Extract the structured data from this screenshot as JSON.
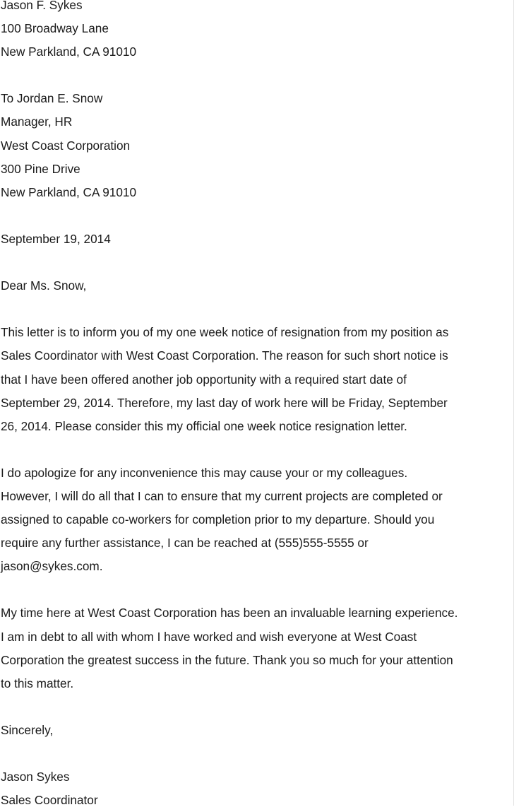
{
  "sender": {
    "name": "Jason F. Sykes",
    "street": "100 Broadway Lane",
    "city_line": "New Parkland, CA 91010"
  },
  "recipient": {
    "to_line": "To Jordan E. Snow",
    "title": "Manager, HR",
    "company": "West Coast Corporation",
    "street": "300 Pine Drive",
    "city_line": "New Parkland, CA 91010"
  },
  "date": "September 19, 2014",
  "salutation": "Dear Ms. Snow,",
  "paragraphs": [
    [
      "This letter is to inform you of my one week notice of resignation from my position as",
      "Sales Coordinator with West Coast Corporation. The reason for such short notice is",
      "that I have been offered another job opportunity with a required start date of",
      "September 29, 2014. Therefore, my last day of work here will be Friday, September",
      "26, 2014. Please consider this my official one week notice resignation letter."
    ],
    [
      "I do apologize for any inconvenience this may cause your or my colleagues.",
      "However, I will do all that I can to ensure that my current projects are completed or",
      "assigned to capable co-workers for completion prior to my departure. Should you",
      "require any further assistance, I can be reached at (555)555-5555 or",
      "jason@sykes.com."
    ],
    [
      "My time here at West Coast Corporation has been an invaluable learning experience.",
      "I am in debt to all with whom I have worked and wish everyone at West Coast",
      "Corporation the greatest success in the future. Thank you so much for your attention",
      "to this matter."
    ]
  ],
  "closing": "Sincerely,",
  "signature": {
    "name": "Jason Sykes",
    "title": "Sales Coordinator"
  }
}
